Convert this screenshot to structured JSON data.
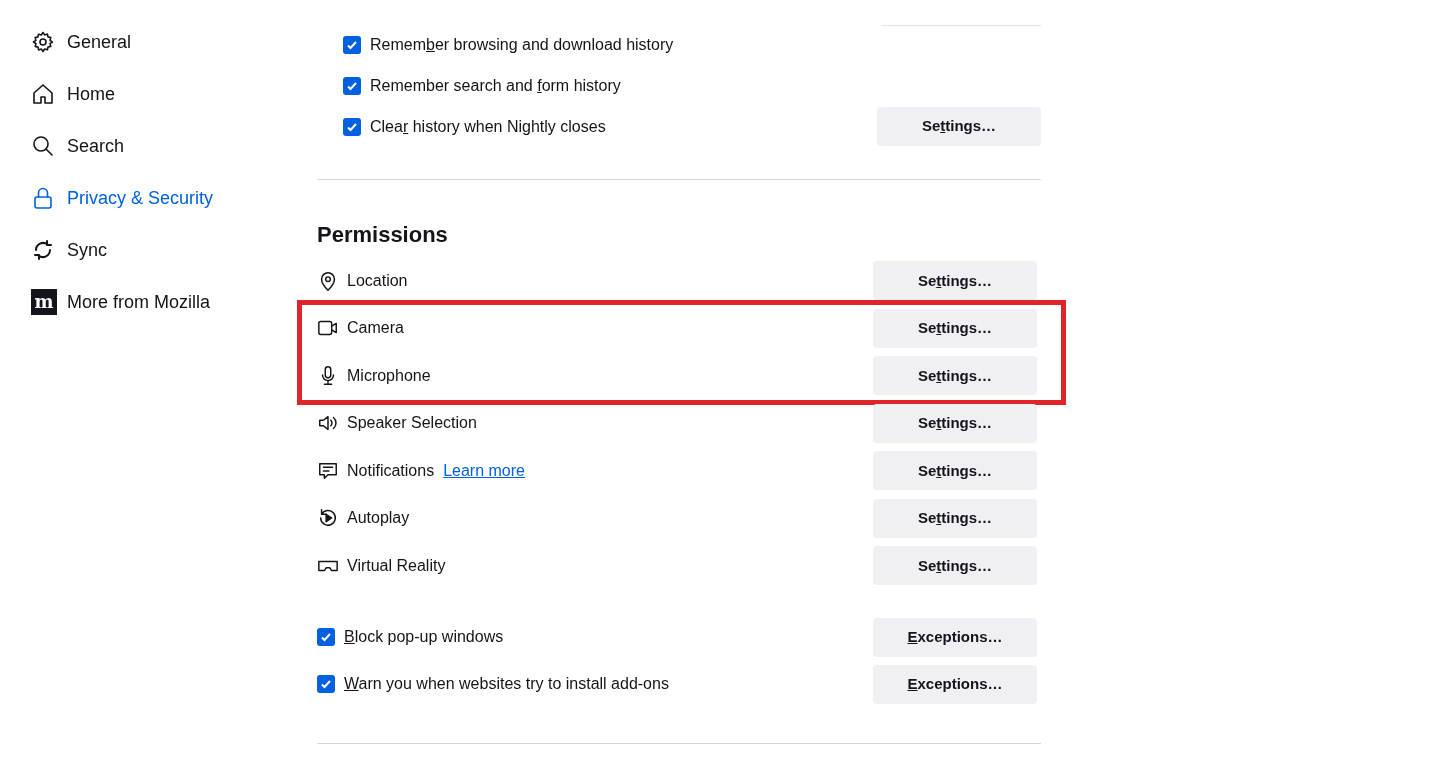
{
  "sidebar": {
    "items": [
      {
        "label": "General",
        "selected": false
      },
      {
        "label": "Home",
        "selected": false
      },
      {
        "label": "Search",
        "selected": false
      },
      {
        "label": "Privacy & Security",
        "selected": true
      },
      {
        "label": "Sync",
        "selected": false
      },
      {
        "logo_text": "m",
        "label": "More from Mozilla",
        "selected": false
      }
    ]
  },
  "history": {
    "options": [
      {
        "pre": "Remem",
        "key": "b",
        "post": "er browsing and download history",
        "checked": true
      },
      {
        "pre": "Remember search and ",
        "key": "f",
        "post": "orm history",
        "checked": true
      },
      {
        "pre": "Clea",
        "key": "r",
        "post": " history when Nightly closes",
        "checked": true,
        "button": {
          "pre": "Se",
          "key": "t",
          "post": "tings…"
        }
      }
    ]
  },
  "permissions": {
    "title": "Permissions",
    "row_groups": [
      {
        "highlighted": false,
        "rows": [
          {
            "label": "Location",
            "button": {
              "pre": "Se",
              "key": "t",
              "post": "tings…"
            }
          }
        ]
      },
      {
        "highlighted": true,
        "rows": [
          {
            "label": "Camera",
            "button": {
              "pre": "Se",
              "key": "t",
              "post": "tings…"
            }
          },
          {
            "label": "Microphone",
            "button": {
              "pre": "Se",
              "key": "t",
              "post": "tings…"
            }
          }
        ]
      },
      {
        "highlighted": false,
        "rows": [
          {
            "label": "Speaker Selection",
            "button": {
              "pre": "Se",
              "key": "t",
              "post": "tings…"
            }
          },
          {
            "label": "Notifications",
            "link": "Learn more",
            "button": {
              "pre": "Se",
              "key": "t",
              "post": "tings…"
            }
          },
          {
            "label": "Autoplay",
            "button": {
              "pre": "Se",
              "key": "t",
              "post": "tings…"
            }
          },
          {
            "label": "Virtual Reality",
            "button": {
              "pre": "Se",
              "key": "t",
              "post": "tings…"
            }
          }
        ]
      }
    ],
    "options": [
      {
        "key": "B",
        "post": "lock pop-up windows",
        "checked": true,
        "button": {
          "key": "E",
          "post": "xceptions…"
        }
      },
      {
        "key": "W",
        "post": "arn you when websites try to install add-ons",
        "checked": true,
        "button": {
          "key": "E",
          "post": "xceptions…"
        }
      }
    ]
  }
}
